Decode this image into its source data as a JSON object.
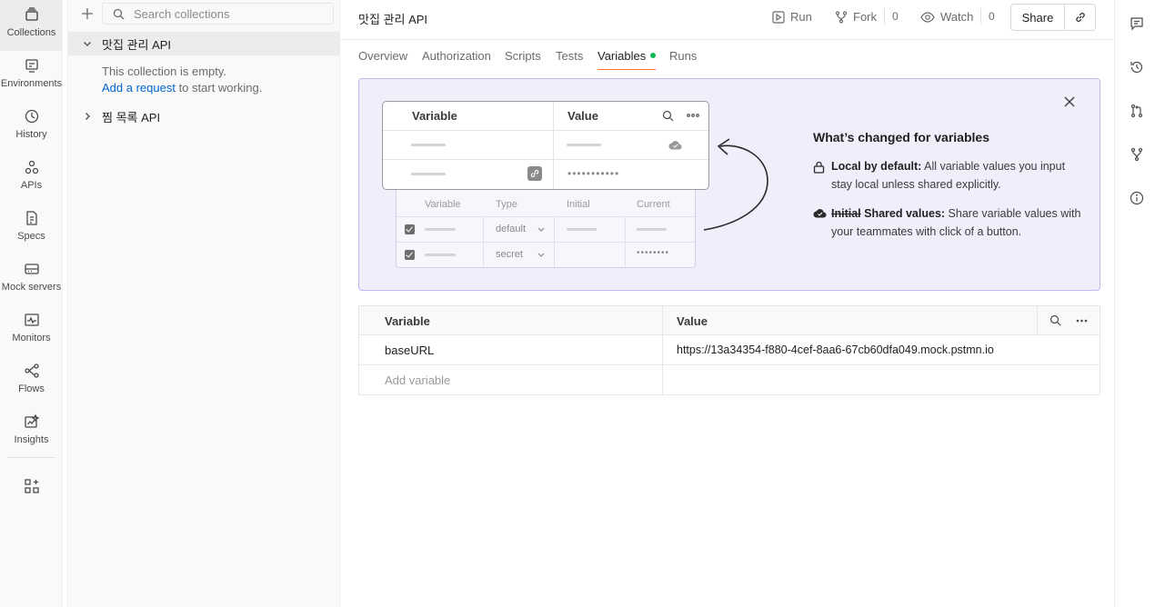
{
  "rail": {
    "items": [
      {
        "label": "Collections",
        "icon": "collections-icon"
      },
      {
        "label": "Environments",
        "icon": "environments-icon"
      },
      {
        "label": "History",
        "icon": "history-icon"
      },
      {
        "label": "APIs",
        "icon": "apis-icon"
      },
      {
        "label": "Specs",
        "icon": "specs-icon"
      },
      {
        "label": "Mock servers",
        "icon": "mock-servers-icon"
      },
      {
        "label": "Monitors",
        "icon": "monitors-icon"
      },
      {
        "label": "Flows",
        "icon": "flows-icon"
      },
      {
        "label": "Insights",
        "icon": "insights-icon"
      }
    ]
  },
  "sidebar": {
    "search_placeholder": "Search collections",
    "collections": [
      {
        "name": "맛집 관리 API",
        "expanded": true
      },
      {
        "name": "찜 목록 API",
        "expanded": false
      }
    ],
    "empty_text": "This collection is empty.",
    "add_request_link": "Add a request",
    "empty_suffix": " to start working."
  },
  "header": {
    "title": "맛집 관리 API",
    "run_label": "Run",
    "fork_label": "Fork",
    "fork_count": "0",
    "watch_label": "Watch",
    "watch_count": "0",
    "share_label": "Share"
  },
  "tabs": [
    {
      "label": "Overview"
    },
    {
      "label": "Authorization"
    },
    {
      "label": "Scripts"
    },
    {
      "label": "Tests"
    },
    {
      "label": "Variables",
      "active": true
    },
    {
      "label": "Runs"
    }
  ],
  "banner": {
    "title": "What’s changed for variables",
    "point1_bold": "Local by default:",
    "point1_text": " All variable values you input stay local unless shared explicitly.",
    "point2_strike": "Initial",
    "point2_bold": " Shared values:",
    "point2_text": " Share variable values with your teammates with click of a button.",
    "illus": {
      "new_variable": "Variable",
      "new_value": "Value",
      "old_variable": "Variable",
      "old_type": "Type",
      "old_initial": "Initial",
      "old_current": "Current",
      "old_row1_type": "default",
      "old_row2_type": "secret",
      "masked": "•••••••••••",
      "masked_short": "••••••••"
    }
  },
  "variables_table": {
    "col_variable": "Variable",
    "col_value": "Value",
    "rows": [
      {
        "variable": "baseURL",
        "value": "https://13a34354-f880-4cef-8aa6-67cb60dfa049.mock.pstmn.io"
      }
    ],
    "add_placeholder": "Add variable"
  },
  "colors": {
    "accent": "#ff6c37",
    "link": "#0265d2",
    "status_dot": "#0cbb52",
    "banner_bg": "#f1eefc",
    "banner_border": "#c3b6f2"
  }
}
